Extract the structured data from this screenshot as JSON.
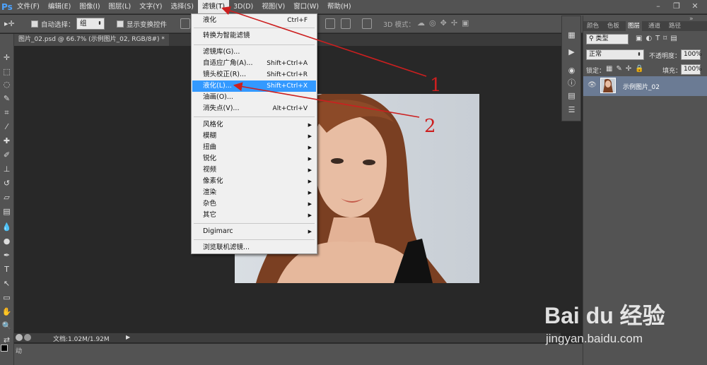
{
  "app": {
    "logo": "Ps"
  },
  "menubar": {
    "items": [
      "文件(F)",
      "编辑(E)",
      "图像(I)",
      "图层(L)",
      "文字(Y)",
      "选择(S)",
      "滤镜(T)",
      "3D(D)",
      "视图(V)",
      "窗口(W)",
      "帮助(H)"
    ],
    "active_index": 6
  },
  "optionsbar": {
    "auto_select_label": "自动选择：",
    "auto_select_value": "组",
    "transform_controls_label": "显示变换控件",
    "mode_3d_label": "3D 模式："
  },
  "document": {
    "tab_title": "图片_02.psd @ 66.7% (示例图片_02, RGB/8#) *",
    "status_doc": "文档:1.02M/1.92M",
    "timeline_label": "动"
  },
  "filter_menu": {
    "items": [
      {
        "label": "液化",
        "shortcut": "Ctrl+F",
        "submenu": false
      },
      {
        "sep": true
      },
      {
        "label": "转换为智能滤镜",
        "shortcut": "",
        "submenu": false
      },
      {
        "sep": true
      },
      {
        "label": "滤镜库(G)...",
        "shortcut": "",
        "submenu": false
      },
      {
        "label": "自适应广角(A)...",
        "shortcut": "Shift+Ctrl+A",
        "submenu": false
      },
      {
        "label": "镜头校正(R)...",
        "shortcut": "Shift+Ctrl+R",
        "submenu": false
      },
      {
        "label": "液化(L)...",
        "shortcut": "Shift+Ctrl+X",
        "submenu": false,
        "highlighted": true
      },
      {
        "label": "油画(O)...",
        "shortcut": "",
        "submenu": false
      },
      {
        "label": "消失点(V)...",
        "shortcut": "Alt+Ctrl+V",
        "submenu": false
      },
      {
        "sep": true
      },
      {
        "label": "风格化",
        "shortcut": "",
        "submenu": true
      },
      {
        "label": "模糊",
        "shortcut": "",
        "submenu": true
      },
      {
        "label": "扭曲",
        "shortcut": "",
        "submenu": true
      },
      {
        "label": "锐化",
        "shortcut": "",
        "submenu": true
      },
      {
        "label": "视频",
        "shortcut": "",
        "submenu": true
      },
      {
        "label": "像素化",
        "shortcut": "",
        "submenu": true
      },
      {
        "label": "渲染",
        "shortcut": "",
        "submenu": true
      },
      {
        "label": "杂色",
        "shortcut": "",
        "submenu": true
      },
      {
        "label": "其它",
        "shortcut": "",
        "submenu": true
      },
      {
        "sep": true
      },
      {
        "label": "Digimarc",
        "shortcut": "",
        "submenu": true
      },
      {
        "sep": true
      },
      {
        "label": "浏览联机滤镜...",
        "shortcut": "",
        "submenu": false
      }
    ]
  },
  "annotations": {
    "arrow1_number": "1",
    "arrow2_number": "2"
  },
  "layers_panel": {
    "tabs": [
      "颜色",
      "色板",
      "图层",
      "通道",
      "路径"
    ],
    "active_tab": 2,
    "filter_kind": "类型",
    "blend_mode": "正常",
    "opacity_label": "不透明度：",
    "opacity_value": "100%",
    "lock_label": "锁定：",
    "fill_label": "填充：",
    "fill_value": "100%",
    "layer_name": "示例图片_02"
  },
  "watermark": {
    "brand": "Bai du 经验",
    "url": "jingyan.baidu.com"
  },
  "colors": {
    "highlight": "#3399ff",
    "arrow": "#cc1f1f",
    "layer_selected": "#6b7b94",
    "ps_blue": "#4da3ff"
  }
}
